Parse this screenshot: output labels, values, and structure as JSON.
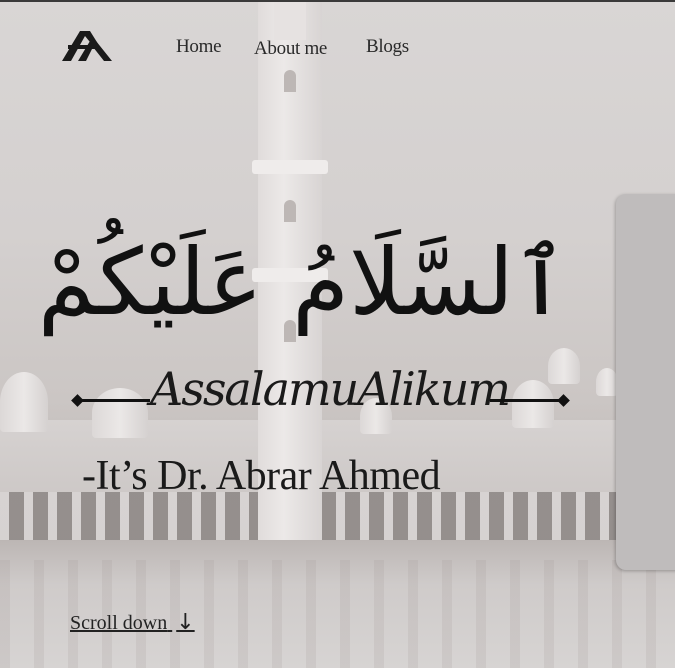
{
  "nav": {
    "logo_icon": "ah-monogram-icon",
    "items": [
      {
        "label": "Home"
      },
      {
        "label": "About me"
      },
      {
        "label": "Blogs"
      }
    ]
  },
  "hero": {
    "arabic_greeting": "ٱلسَّلَامُ عَلَيْكُمْ",
    "transliteration": "AssalamuAlikum",
    "intro": "-It’s Dr. Abrar Ahmed",
    "scroll_label": "Scroll down",
    "scroll_icon": "arrow-down-icon",
    "scroll_glyph": "↓"
  },
  "colors": {
    "text": "#111111",
    "panel": "#bfbcbc"
  }
}
